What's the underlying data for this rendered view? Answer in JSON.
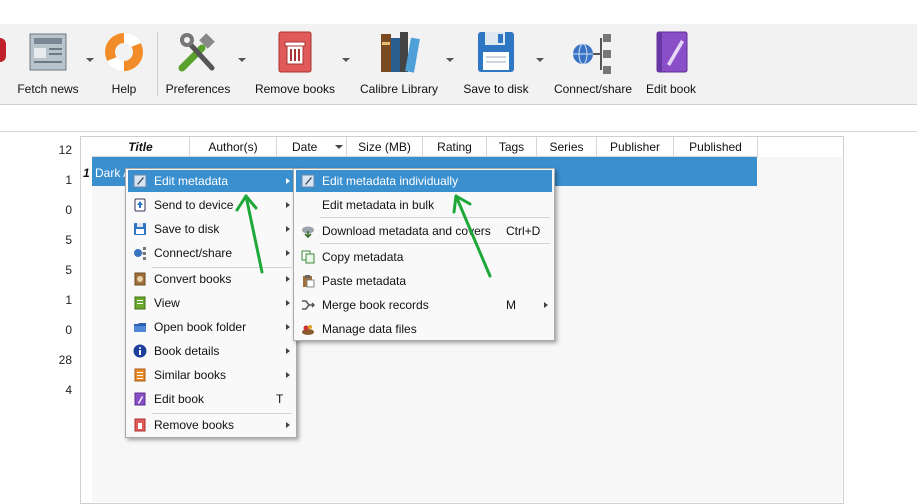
{
  "toolbar": {
    "items": [
      {
        "label": "Fetch news",
        "icon": "newspaper-icon"
      },
      {
        "label": "Help",
        "icon": "lifebuoy-icon"
      },
      {
        "label": "Preferences",
        "icon": "tools-icon"
      },
      {
        "label": "Remove books",
        "icon": "trash-book-icon"
      },
      {
        "label": "Calibre Library",
        "icon": "library-books-icon"
      },
      {
        "label": "Save to disk",
        "icon": "floppy-disk-icon"
      },
      {
        "label": "Connect/share",
        "icon": "network-share-icon"
      },
      {
        "label": "Edit book",
        "icon": "edit-book-icon"
      }
    ]
  },
  "row_numbers": [
    "12",
    "1",
    "0",
    "5",
    "5",
    "1",
    "0",
    "28",
    "4"
  ],
  "table": {
    "columns": [
      "Title",
      "Author(s)",
      "Date",
      "Size (MB)",
      "Rating",
      "Tags",
      "Series",
      "Publisher",
      "Published"
    ],
    "sort_column": "Date",
    "rows": [
      {
        "index": "1",
        "title": "Dark A"
      }
    ]
  },
  "context_menu": {
    "items": [
      {
        "label": "Edit metadata",
        "icon": "edit-metadata-icon",
        "shortcut": "",
        "submenu": true,
        "highlighted": true
      },
      {
        "label": "Send to device",
        "icon": "send-device-icon",
        "shortcut": "",
        "submenu": true
      },
      {
        "label": "Save to disk",
        "icon": "floppy-disk-icon",
        "shortcut": "",
        "submenu": true
      },
      {
        "label": "Connect/share",
        "icon": "network-share-icon",
        "shortcut": "",
        "submenu": true
      },
      {
        "label": "Convert books",
        "icon": "convert-books-icon",
        "shortcut": "",
        "submenu": true
      },
      {
        "label": "View",
        "icon": "view-book-icon",
        "shortcut": "",
        "submenu": true
      },
      {
        "label": "Open book folder",
        "icon": "folder-icon",
        "shortcut": "",
        "submenu": true
      },
      {
        "label": "Book details",
        "icon": "info-icon",
        "shortcut": "",
        "submenu": true
      },
      {
        "label": "Similar books",
        "icon": "similar-books-icon",
        "shortcut": "",
        "submenu": true
      },
      {
        "label": "Edit book",
        "icon": "edit-book-icon",
        "shortcut": "T",
        "submenu": false
      },
      {
        "label": "Remove books",
        "icon": "trash-book-icon",
        "shortcut": "",
        "submenu": true
      }
    ]
  },
  "submenu": {
    "items": [
      {
        "label": "Edit metadata individually",
        "icon": "edit-metadata-icon",
        "shortcut": "",
        "submenu": false,
        "highlighted": true
      },
      {
        "label": "Edit metadata in bulk",
        "icon": "",
        "shortcut": "",
        "submenu": false
      },
      {
        "label": "Download metadata and covers",
        "icon": "download-cloud-icon",
        "shortcut": "Ctrl+D",
        "submenu": false
      },
      {
        "label": "Copy metadata",
        "icon": "copy-icon",
        "shortcut": "",
        "submenu": false
      },
      {
        "label": "Paste metadata",
        "icon": "paste-icon",
        "shortcut": "",
        "submenu": false
      },
      {
        "label": "Merge book records",
        "icon": "merge-icon",
        "shortcut": "M",
        "submenu": true
      },
      {
        "label": "Manage data files",
        "icon": "data-files-icon",
        "shortcut": "",
        "submenu": false
      }
    ]
  },
  "colors": {
    "highlight": "#3a8fcf",
    "arrow": "#1fa83a"
  }
}
